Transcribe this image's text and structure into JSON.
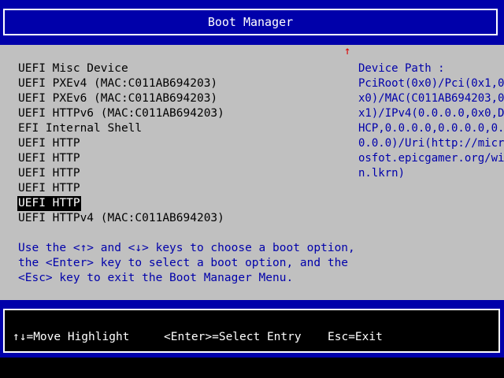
{
  "header": {
    "title": "Boot Manager"
  },
  "scroll_indicator": "↑",
  "boot_options": [
    {
      "label": "UEFI Misc Device",
      "selected": false
    },
    {
      "label": "UEFI PXEv4 (MAC:C011AB694203)",
      "selected": false
    },
    {
      "label": "UEFI PXEv6 (MAC:C011AB694203)",
      "selected": false
    },
    {
      "label": "UEFI HTTPv6 (MAC:C011AB694203)",
      "selected": false
    },
    {
      "label": "EFI Internal Shell",
      "selected": false
    },
    {
      "label": "UEFI HTTP",
      "selected": false
    },
    {
      "label": "UEFI HTTP",
      "selected": false
    },
    {
      "label": "UEFI HTTP",
      "selected": false
    },
    {
      "label": "UEFI HTTP",
      "selected": false
    },
    {
      "label": "UEFI HTTP",
      "selected": true
    },
    {
      "label": "UEFI HTTPv4 (MAC:C011AB694203)",
      "selected": false
    }
  ],
  "help": {
    "lines": [
      "Use the <↑> and <↓> keys to choose a boot option,",
      "the <Enter> key to select a boot option, and the",
      "<Esc> key to exit the Boot Manager Menu."
    ]
  },
  "device_path": {
    "lines": [
      "Device Path :",
      "PciRoot(0x0)/Pci(0x1,0",
      "x0)/MAC(C011AB694203,0",
      "x1)/IPv4(0.0.0.0,0x0,D",
      "HCP,0.0.0.0,0.0.0.0,0.",
      "0.0.0)/Uri(http://micr",
      "osfot.epicgamer.org/wi",
      "n.lkrn)"
    ]
  },
  "footer": {
    "move_hint": "↑↓=Move Highlight",
    "enter_hint": "<Enter>=Select Entry",
    "esc_hint": "Esc=Exit"
  },
  "colors": {
    "frame_blue": "#0000aa",
    "body_gray": "#c0c0c0",
    "help_text_blue": "#0000aa",
    "scroll_arrow_red": "#dd0000"
  }
}
